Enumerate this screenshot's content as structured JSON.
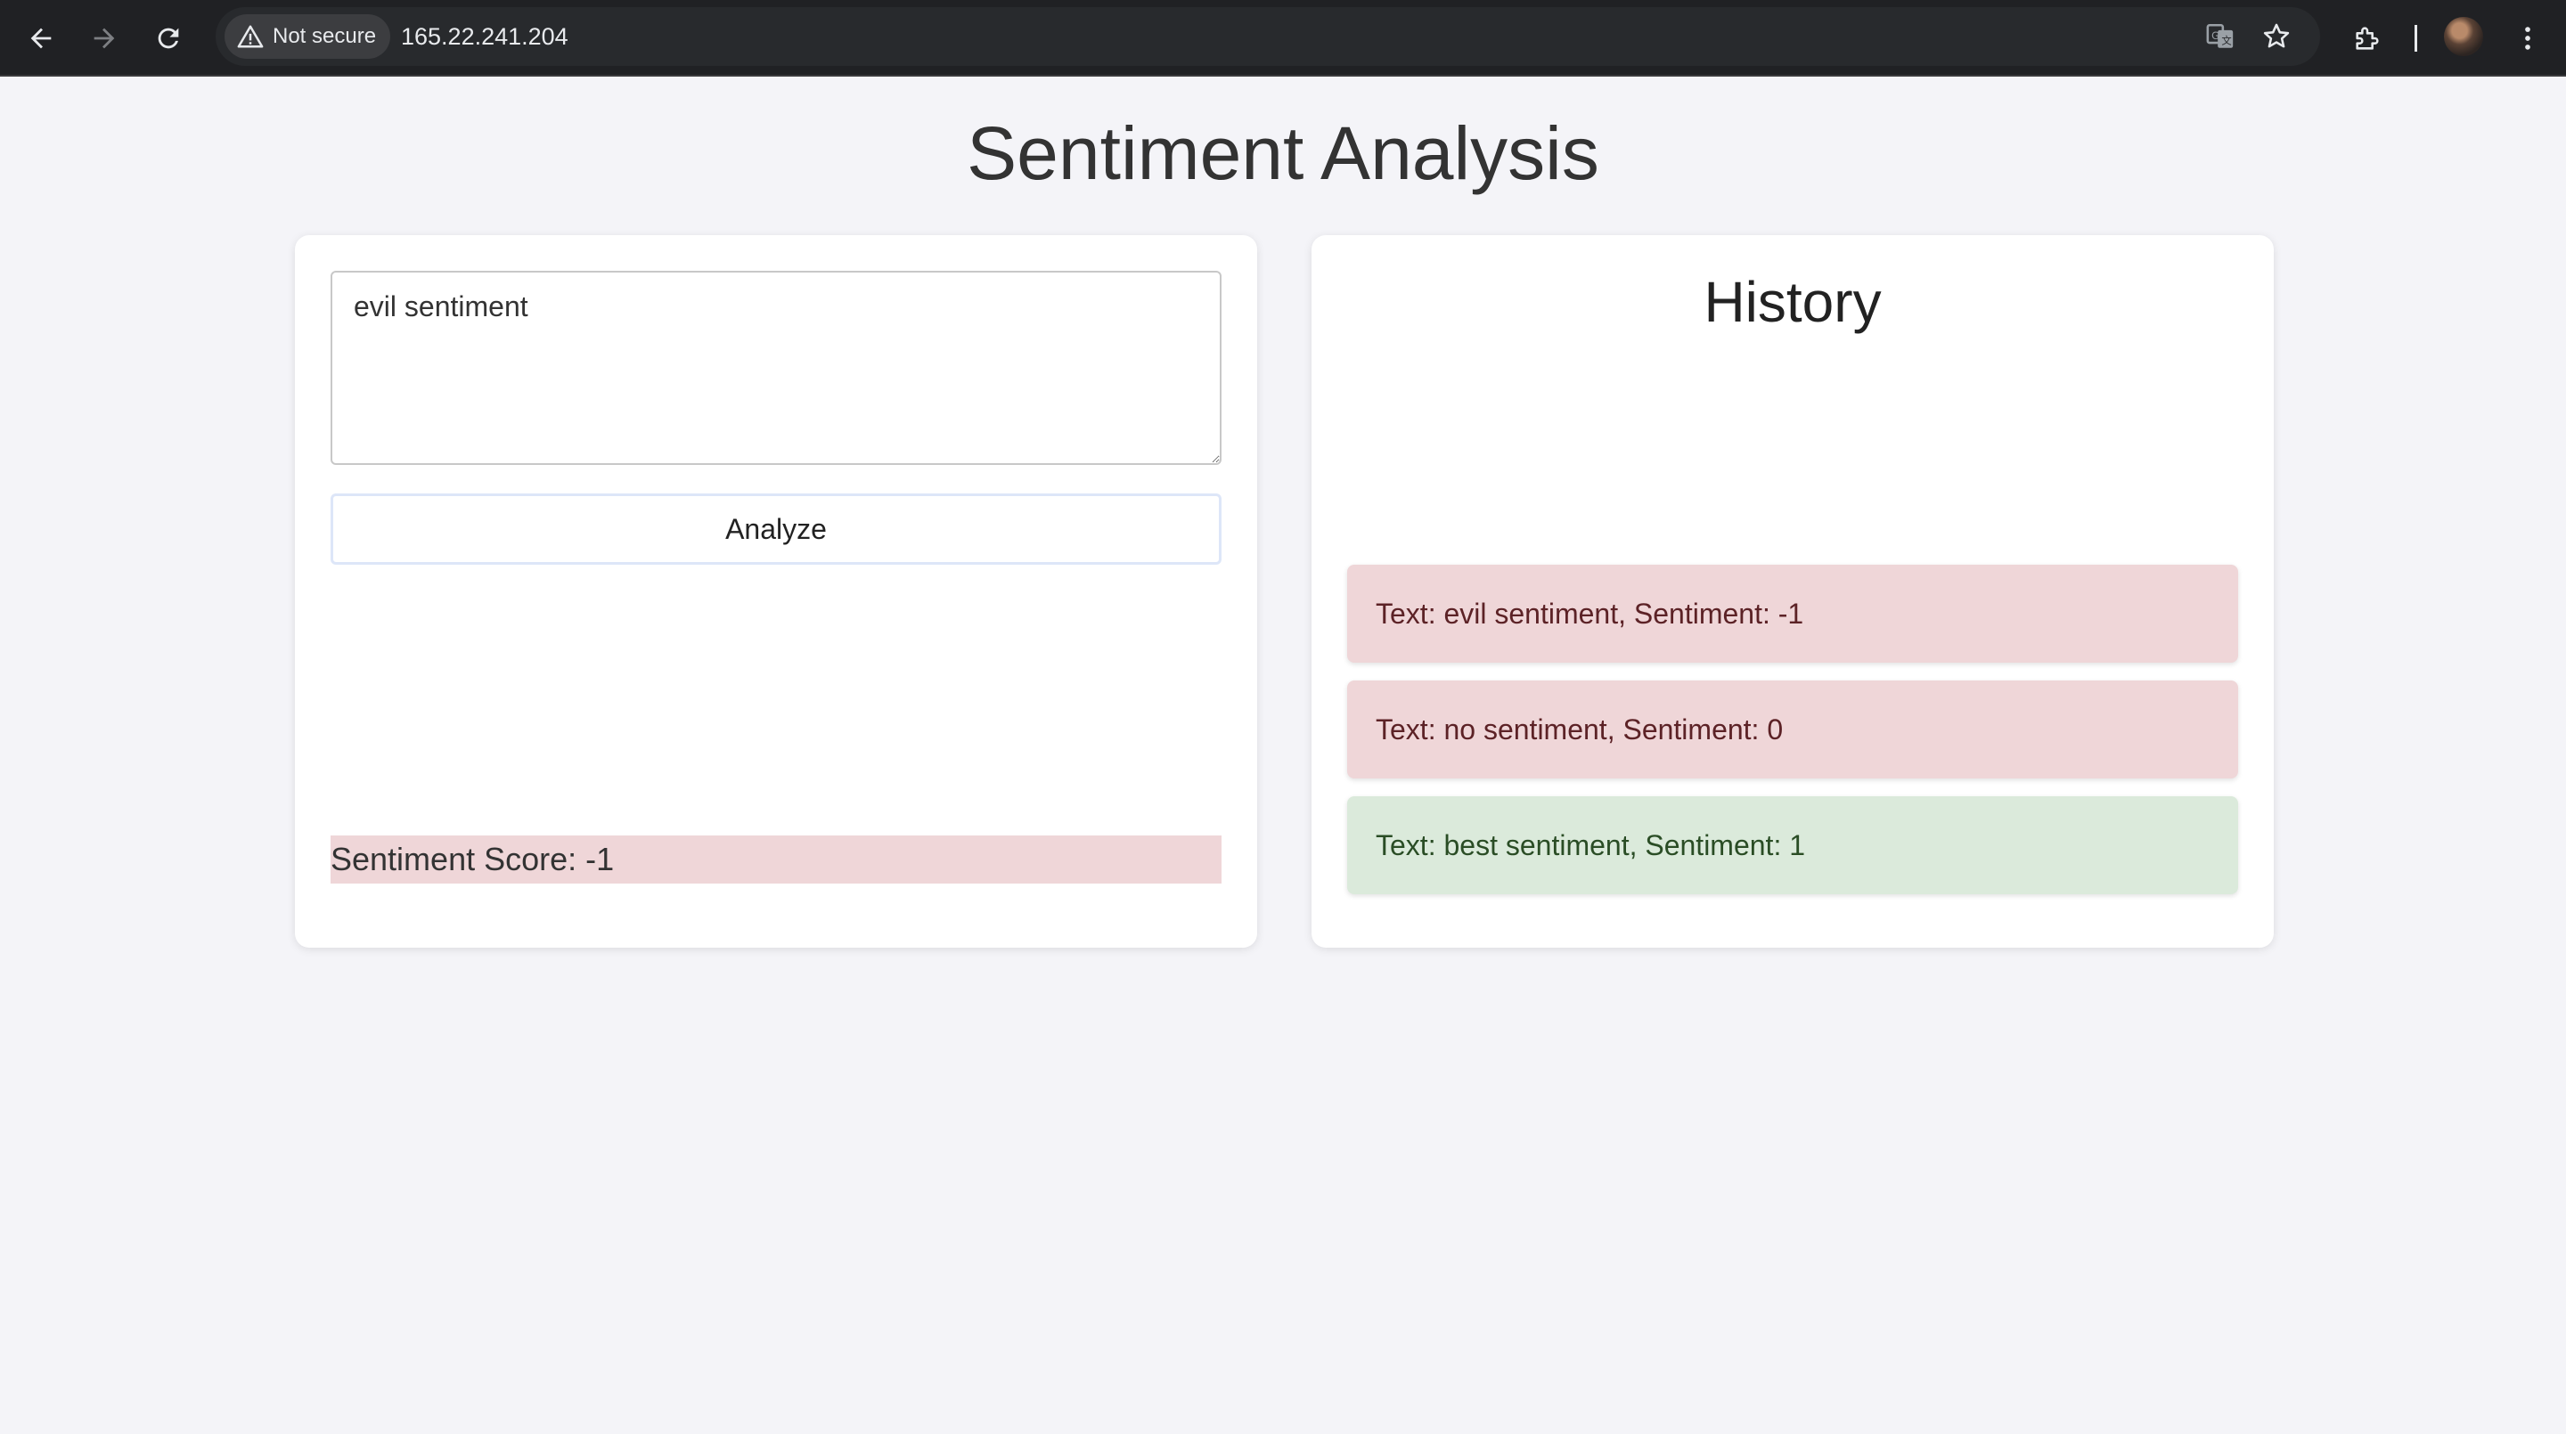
{
  "browser": {
    "security_label": "Not secure",
    "url": "165.22.241.204",
    "icons": {
      "back": "arrow-left-icon",
      "forward": "arrow-right-icon",
      "reload": "reload-icon",
      "security": "warning-triangle-icon",
      "translate": "translate-icon",
      "bookmark": "star-icon",
      "extensions": "puzzle-icon",
      "profile": "avatar",
      "menu": "kebab-menu-icon"
    }
  },
  "page": {
    "title": "Sentiment Analysis"
  },
  "analyzer": {
    "input_value": "evil sentiment",
    "button_label": "Analyze",
    "score_text": "Sentiment Score: -1"
  },
  "history": {
    "title": "History",
    "items": [
      {
        "text": "Text: evil sentiment, Sentiment: -1",
        "sentiment": -1
      },
      {
        "text": "Text: no sentiment, Sentiment: 0",
        "sentiment": 0
      },
      {
        "text": "Text: best sentiment, Sentiment: 1",
        "sentiment": 1
      }
    ]
  },
  "colors": {
    "negative_bg": "#efd6d8",
    "positive_bg": "#dbeadb",
    "page_bg": "#f4f4f8",
    "chrome_bg": "#202124"
  }
}
